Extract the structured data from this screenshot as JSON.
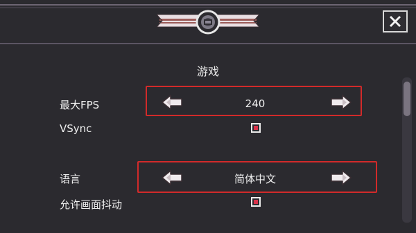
{
  "header": {
    "close_icon": "close-icon",
    "emblem_icon": "gear-emblem-icon"
  },
  "section": {
    "title": "游戏"
  },
  "settings": {
    "max_fps": {
      "label": "最大FPS",
      "value": "240"
    },
    "vsync": {
      "label": "VSync",
      "checked": true
    },
    "language": {
      "label": "语言",
      "value": "简体中文"
    },
    "screen_shake": {
      "label": "允许画面抖动",
      "checked": true
    }
  },
  "colors": {
    "highlight": "#d22a2a",
    "checkbox_fill": "#d8324a",
    "ribbon_stripe": "#9b5b58"
  }
}
